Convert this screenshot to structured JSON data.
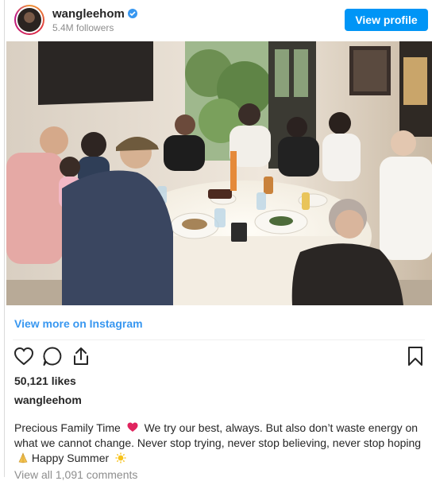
{
  "header": {
    "username": "wangleehom",
    "followers": "5.4M followers",
    "view_profile_label": "View profile"
  },
  "links": {
    "view_more": "View more on Instagram",
    "view_comments": "View all 1,091 comments"
  },
  "post": {
    "likes": "50,121 likes",
    "username": "wangleehom",
    "caption_part1": "Precious Family Time",
    "caption_part2": "We try our best, always. But also don’t waste energy on what we cannot change. Never stop trying, never stop believing, never stop hoping",
    "caption_part3": "Happy Summer"
  },
  "icons": [
    "verified-badge-icon",
    "heart-icon",
    "comment-icon",
    "share-icon",
    "bookmark-icon",
    "red-heart-emoji",
    "praying-hands-emoji",
    "sun-emoji"
  ],
  "colors": {
    "accent": "#0095f6",
    "link": "#3897f0",
    "muted": "#8e8e8e",
    "heart": "#e0245e"
  }
}
